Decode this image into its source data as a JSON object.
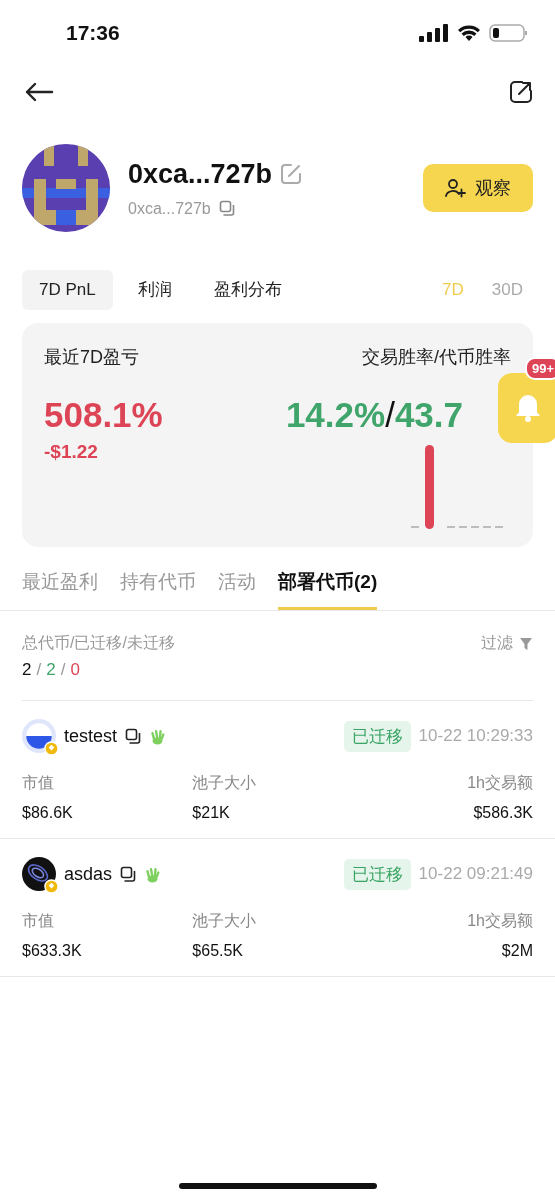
{
  "status_bar": {
    "time": "17:36"
  },
  "profile": {
    "name": "0xca...727b",
    "address": "0xca...727b",
    "watch_button": "观察"
  },
  "chart_tabs": [
    {
      "label": "7D PnL",
      "selected": true
    },
    {
      "label": "利润",
      "selected": false
    },
    {
      "label": "盈利分布",
      "selected": false
    }
  ],
  "ranges": [
    {
      "label": "7D",
      "selected": true
    },
    {
      "label": "30D",
      "selected": false
    }
  ],
  "summary": {
    "pnl_label": "最近7D盈亏",
    "pnl_percent": "508.1%",
    "pnl_amount": "-$1.22",
    "winrate_label": "交易胜率/代币胜率",
    "trade_winrate": "14.2%",
    "separator": "/",
    "token_winrate": "43.7"
  },
  "notification_badge": "99+",
  "tabs": [
    {
      "label": "最近盈利",
      "selected": false
    },
    {
      "label": "持有代币",
      "selected": false
    },
    {
      "label": "活动",
      "selected": false
    },
    {
      "label": "部署代币(2)",
      "selected": true
    }
  ],
  "deploy_stats": {
    "label": "总代币/已迁移/未迁移",
    "total": "2",
    "migrated": "2",
    "unmigrated": "0",
    "separators": [
      "/",
      "/"
    ],
    "filter": "过滤"
  },
  "tokens": [
    {
      "name": "testest",
      "kind": "half",
      "status": "已迁移",
      "time": "10-22 10:29:33",
      "metrics": [
        {
          "label": "市值",
          "value": "$86.6K"
        },
        {
          "label": "池子大小",
          "value": "$21K"
        },
        {
          "label": "1h交易额",
          "value": "$586.3K"
        }
      ]
    },
    {
      "name": "asdas",
      "kind": "dark",
      "status": "已迁移",
      "time": "10-22 09:21:49",
      "metrics": [
        {
          "label": "市值",
          "value": "$633.3K"
        },
        {
          "label": "池子大小",
          "value": "$65.5K"
        },
        {
          "label": "1h交易额",
          "value": "$2M"
        }
      ]
    }
  ]
}
